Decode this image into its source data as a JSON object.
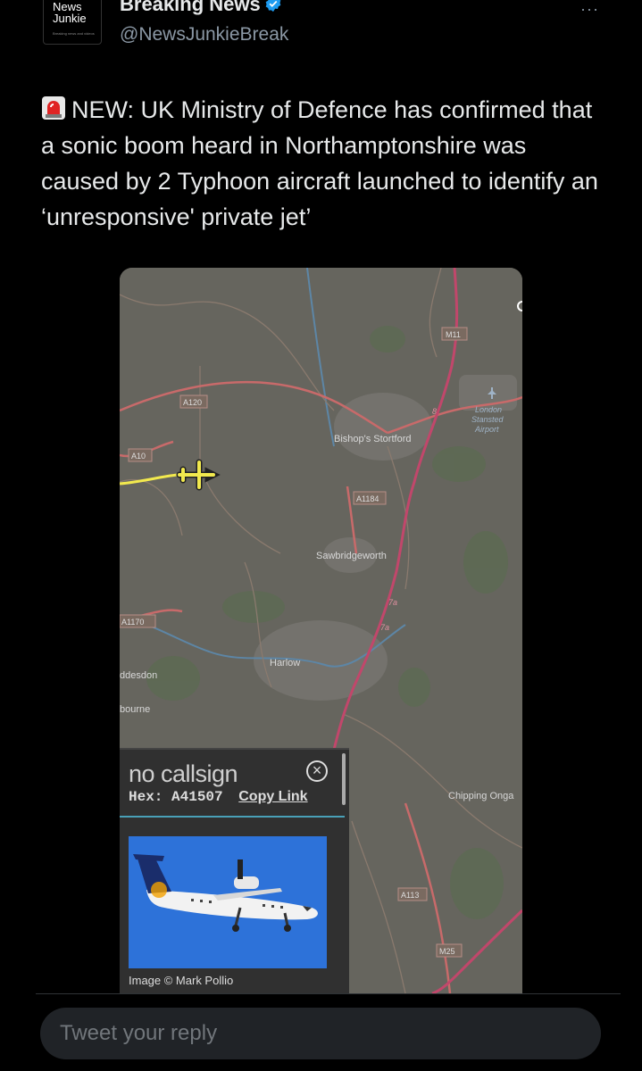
{
  "header": {
    "avatar_line1": "News",
    "avatar_line2": "Junkie",
    "avatar_tagline": "Breaking news and videos",
    "display_name": "Breaking News",
    "handle": "@NewsJunkieBreak",
    "more_label": "···"
  },
  "tweet": {
    "text": "NEW: UK Ministry of Defence has confirmed that a sonic boom heard in Northamptonshire was caused by 2 Typhoon aircraft launched to identify an ‘unresponsive' private jet’"
  },
  "map": {
    "labels": {
      "a120": "A120",
      "a10": "A10",
      "m11": "M11",
      "a1184": "A1184",
      "a1170": "A1170",
      "a113": "A113",
      "m25": "M25",
      "bishops_stortford": "Bishop's Stortford",
      "sawbridgeworth": "Sawbridgeworth",
      "harlow": "Harlow",
      "hoddesdon": "ddesdon",
      "broxbourne": "bourne",
      "chipping_ongar": "Chipping Onga",
      "stansted_1": "London",
      "stansted_2": "Stansted",
      "stansted_3": "Airport",
      "junction_8": "8",
      "junction_7a_1": "7a",
      "junction_7a_2": "7a"
    },
    "popup": {
      "callsign": "no callsign",
      "hex_label": "Hex:",
      "hex_value": "A41507",
      "copy_link": "Copy Link",
      "close": "×",
      "credit": "Image © Mark Pollio"
    }
  },
  "reply": {
    "placeholder": "Tweet your reply"
  },
  "colors": {
    "background": "#000000",
    "text": "#e7e9ea",
    "secondary": "#8b98a5",
    "verified": "#1d9bf0",
    "map_base": "#66655e",
    "road": "#c86a6a",
    "flight_path": "#f2e94e"
  }
}
